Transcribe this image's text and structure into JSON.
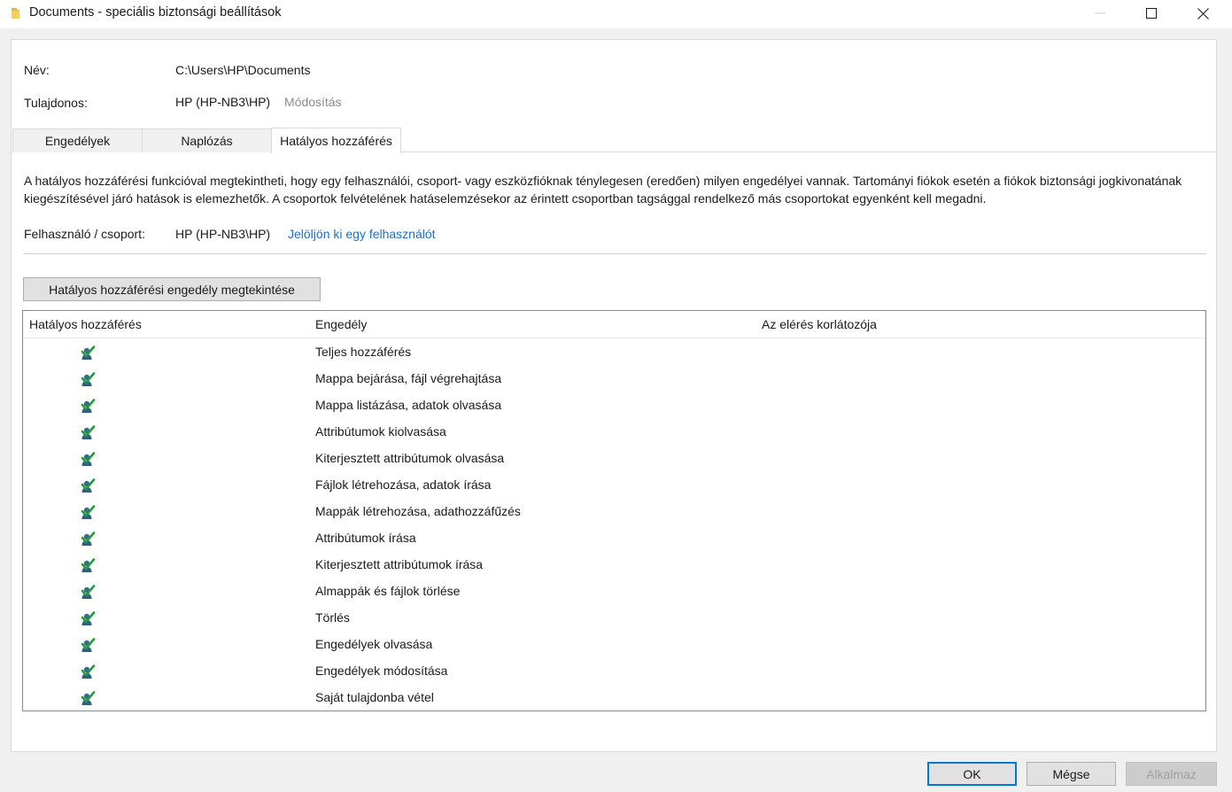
{
  "window": {
    "title": "Documents - speciális biztonsági beállítások",
    "icon": "folder-icon",
    "controls": [
      "minimize-icon",
      "maximize-icon",
      "close-icon"
    ]
  },
  "info": {
    "name_label": "Név:",
    "name_value": "C:\\Users\\HP\\Documents",
    "owner_label": "Tulajdonos:",
    "owner_value": "HP (HP-NB3\\HP)",
    "owner_change_link": "Módosítás"
  },
  "tabs": [
    {
      "label": "Engedélyek",
      "active": false
    },
    {
      "label": "Naplózás",
      "active": false
    },
    {
      "label": "Hatályos hozzáférés",
      "active": true
    }
  ],
  "effective_access": {
    "description": "A hatályos hozzáférési funkcióval megtekintheti, hogy egy felhasználói, csoport- vagy eszközfióknak ténylegesen (eredően) milyen engedélyei vannak. Tartományi fiókok esetén a fiókok biztonsági jogkivonatának kiegészítésével járó hatások is elemezhetők. A csoportok felvételének hatáselemzésekor az érintett csoportban tagsággal rendelkező más csoportokat egyenként kell megadni.",
    "user_group_label": "Felhasználó / csoport:",
    "user_group_value": "HP (HP-NB3\\HP)",
    "select_user_link": "Jelöljön ki egy felhasználót",
    "view_button": "Hatályos hozzáférési engedély megtekintése"
  },
  "table": {
    "columns": [
      "Hatályos hozzáférés",
      "Engedély",
      "Az elérés korlátozója"
    ],
    "rows": [
      {
        "access_icon": "user-check-icon",
        "permission": "Teljes hozzáférés",
        "limited_by": ""
      },
      {
        "access_icon": "user-check-icon",
        "permission": "Mappa bejárása, fájl végrehajtása",
        "limited_by": ""
      },
      {
        "access_icon": "user-check-icon",
        "permission": "Mappa listázása, adatok olvasása",
        "limited_by": ""
      },
      {
        "access_icon": "user-check-icon",
        "permission": "Attribútumok kiolvasása",
        "limited_by": ""
      },
      {
        "access_icon": "user-check-icon",
        "permission": "Kiterjesztett attribútumok olvasása",
        "limited_by": ""
      },
      {
        "access_icon": "user-check-icon",
        "permission": "Fájlok létrehozása, adatok írása",
        "limited_by": ""
      },
      {
        "access_icon": "user-check-icon",
        "permission": "Mappák létrehozása, adathozzáfűzés",
        "limited_by": ""
      },
      {
        "access_icon": "user-check-icon",
        "permission": "Attribútumok írása",
        "limited_by": ""
      },
      {
        "access_icon": "user-check-icon",
        "permission": "Kiterjesztett attribútumok írása",
        "limited_by": ""
      },
      {
        "access_icon": "user-check-icon",
        "permission": "Almappák és fájlok törlése",
        "limited_by": ""
      },
      {
        "access_icon": "user-check-icon",
        "permission": "Törlés",
        "limited_by": ""
      },
      {
        "access_icon": "user-check-icon",
        "permission": "Engedélyek olvasása",
        "limited_by": ""
      },
      {
        "access_icon": "user-check-icon",
        "permission": "Engedélyek módosítása",
        "limited_by": ""
      },
      {
        "access_icon": "user-check-icon",
        "permission": "Saját tulajdonba vétel",
        "limited_by": ""
      }
    ]
  },
  "footer": {
    "ok": "OK",
    "cancel": "Mégse",
    "apply": "Alkalmaz"
  },
  "colors": {
    "link_blue": "#1f6fc4",
    "link_gray": "#8c8c8c",
    "default_button_border": "#0078d7",
    "check_green": "#1e9e3a",
    "folder_yellow": "#e8b93c"
  }
}
